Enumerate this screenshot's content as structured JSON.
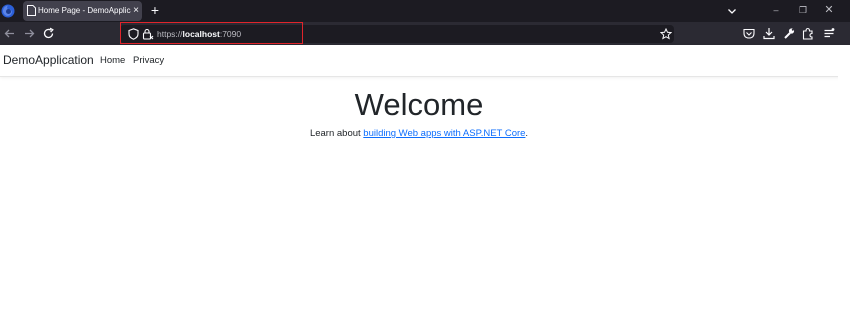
{
  "browser": {
    "tab": {
      "title": "Home Page - DemoApplication",
      "close": "×"
    },
    "new_tab": "+",
    "window_controls": {
      "minimize": "–",
      "maximize": "❐",
      "close": "✕"
    },
    "url": {
      "scheme": "https://",
      "host": "localhost",
      "port": ":7090"
    },
    "icons": [
      "firefox-logo-icon",
      "page-icon",
      "tabs-list-chevron-icon",
      "back-icon",
      "forward-icon",
      "reload-icon",
      "shield-icon",
      "lock-icon",
      "bookmark-star-icon",
      "pocket-icon",
      "downloads-icon",
      "wrench-icon",
      "extensions-icon",
      "menu-icon"
    ],
    "highlight_color": "#e0242b"
  },
  "site": {
    "brand": "DemoApplication",
    "nav": [
      "Home",
      "Privacy"
    ]
  },
  "main": {
    "heading": "Welcome",
    "text_before": "Learn about ",
    "link_text": "building Web apps with ASP.NET Core",
    "text_after": ".",
    "link_color": "#0d6efd"
  }
}
